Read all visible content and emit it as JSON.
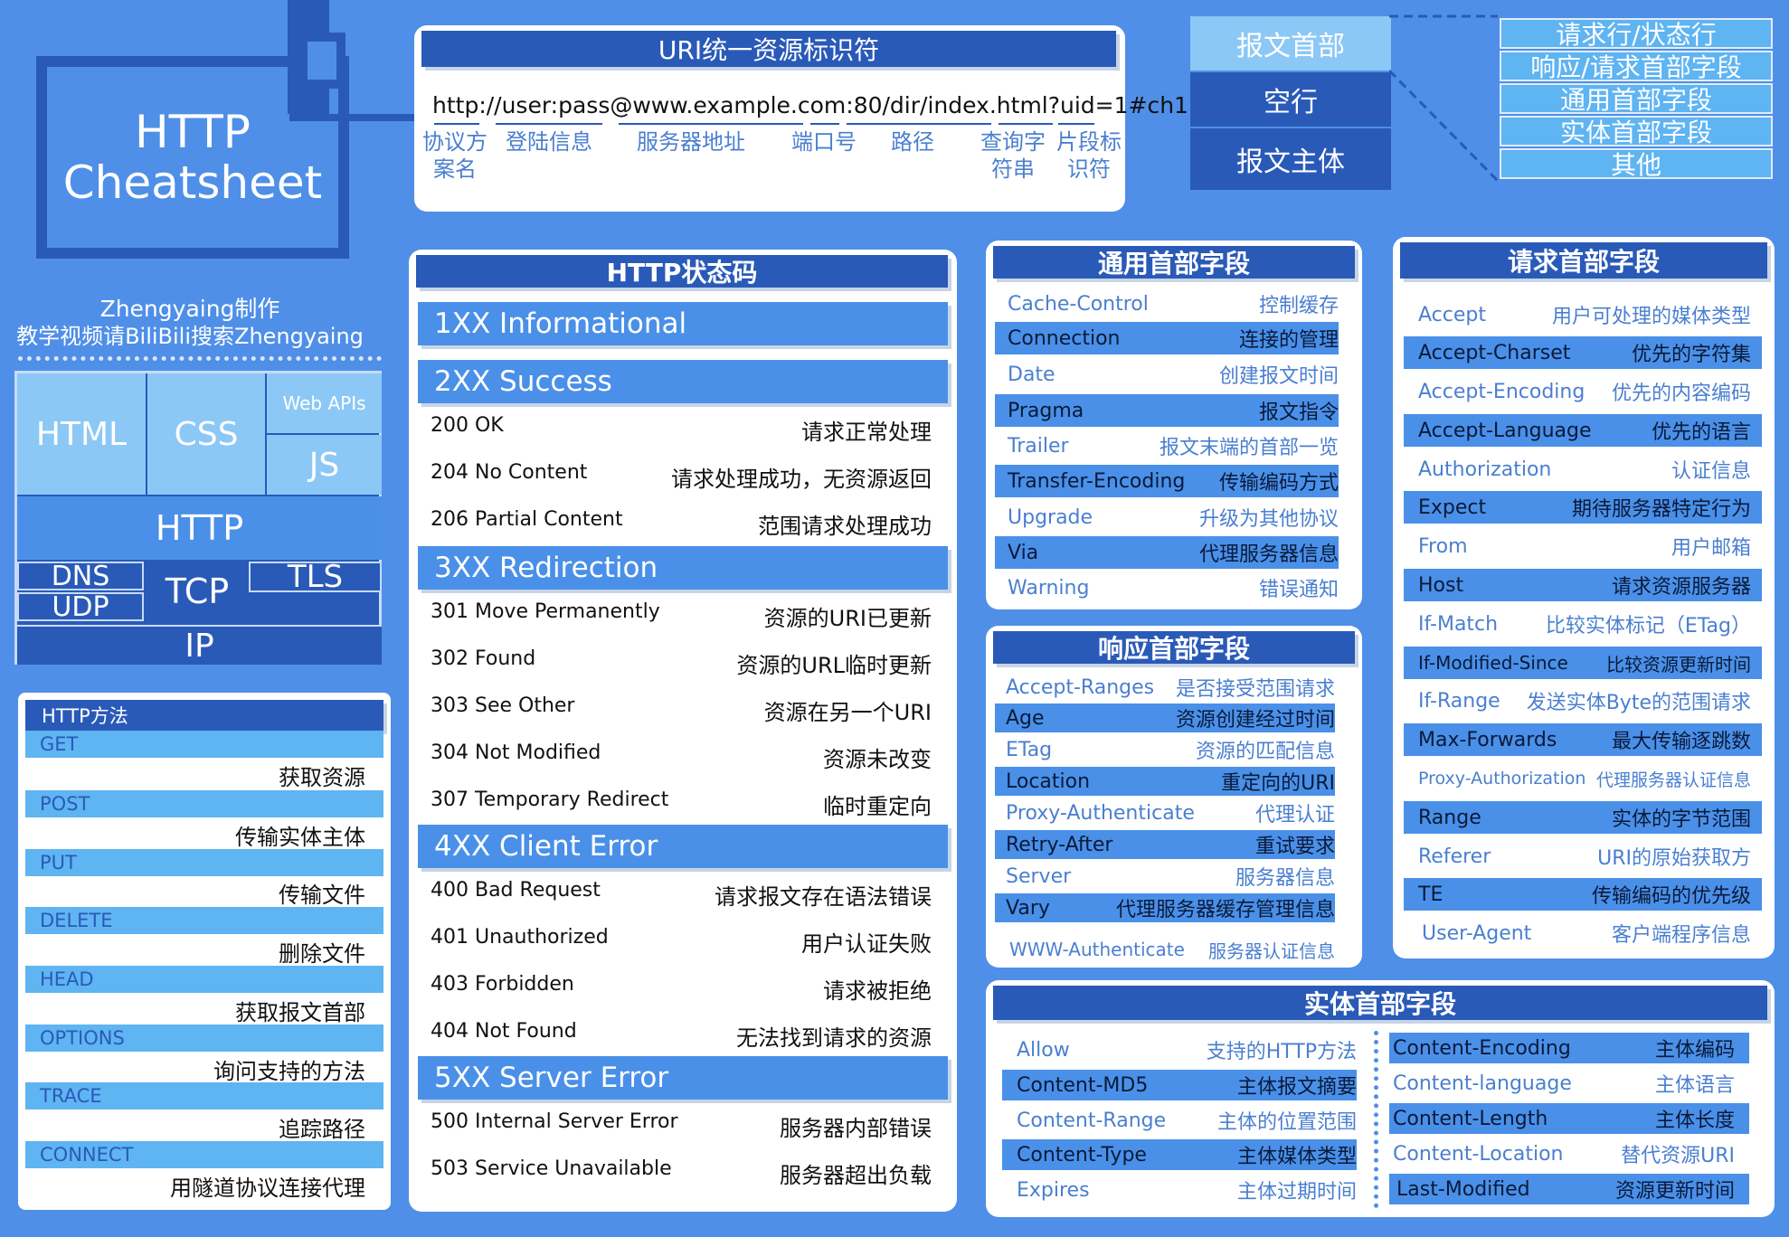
{
  "logo": {
    "line1": "HTTP",
    "line2": "Cheatsheet"
  },
  "credit": {
    "line1": "Zhengyaing制作",
    "line2": "教学视频请BiliBili搜索Zhengyaing"
  },
  "stack": {
    "html": "HTML",
    "css": "CSS",
    "webapis": "Web APIs",
    "js": "JS",
    "http": "HTTP",
    "dns": "DNS",
    "udp": "UDP",
    "tcp": "TCP",
    "tls": "TLS",
    "ip": "IP"
  },
  "uri": {
    "title": "URI统一资源标识符",
    "url": "http://user:pass@www.example.com:80/dir/index.html?uid=1#ch1",
    "labels": {
      "scheme": "协议方案名",
      "login": "登陆信息",
      "host": "服务器地址",
      "port": "端口号",
      "path": "路径",
      "query": "查询字符串",
      "fragment": "片段标识符"
    }
  },
  "message": {
    "header": "报文首部",
    "blank": "空行",
    "body": "报文主体",
    "parts": [
      "请求行/状态行",
      "响应/请求首部字段",
      "通用首部字段",
      "实体首部字段",
      "其他"
    ]
  },
  "status": {
    "title": "HTTP状态码",
    "sections": [
      {
        "name": "1XX Informational",
        "rows": []
      },
      {
        "name": "2XX Success",
        "rows": [
          [
            "200 OK",
            "请求正常处理"
          ],
          [
            "204 No Content",
            "请求处理成功，无资源返回"
          ],
          [
            "206 Partial Content",
            "范围请求处理成功"
          ]
        ]
      },
      {
        "name": "3XX Redirection",
        "rows": [
          [
            "301 Move Permanently",
            "资源的URI已更新"
          ],
          [
            "302 Found",
            "资源的URL临时更新"
          ],
          [
            "303 See Other",
            "资源在另一个URI"
          ],
          [
            "304 Not Modified",
            "资源未改变"
          ],
          [
            "307 Temporary Redirect",
            "临时重定向"
          ]
        ]
      },
      {
        "name": "4XX Client Error",
        "rows": [
          [
            "400 Bad Request",
            "请求报文存在语法错误"
          ],
          [
            "401 Unauthorized",
            "用户认证失败"
          ],
          [
            "403 Forbidden",
            "请求被拒绝"
          ],
          [
            "404 Not Found",
            "无法找到请求的资源"
          ]
        ]
      },
      {
        "name": "5XX Server Error",
        "rows": [
          [
            "500 Internal Server Error",
            "服务器内部错误"
          ],
          [
            "503 Service Unavailable",
            "服务器超出负载"
          ]
        ]
      }
    ]
  },
  "methods": {
    "title": "HTTP方法",
    "items": [
      [
        "GET",
        "获取资源"
      ],
      [
        "POST",
        "传输实体主体"
      ],
      [
        "PUT",
        "传输文件"
      ],
      [
        "DELETE",
        "删除文件"
      ],
      [
        "HEAD",
        "获取报文首部"
      ],
      [
        "OPTIONS",
        "询问支持的方法"
      ],
      [
        "TRACE",
        "追踪路径"
      ],
      [
        "CONNECT",
        "用隧道协议连接代理"
      ]
    ]
  },
  "general": {
    "title": "通用首部字段",
    "rows": [
      [
        "Cache-Control",
        "控制缓存"
      ],
      [
        "Connection",
        "连接的管理"
      ],
      [
        "Date",
        "创建报文时间"
      ],
      [
        "Pragma",
        "报文指令"
      ],
      [
        "Trailer",
        "报文末端的首部一览"
      ],
      [
        "Transfer-Encoding",
        "传输编码方式"
      ],
      [
        "Upgrade",
        "升级为其他协议"
      ],
      [
        "Via",
        "代理服务器信息"
      ],
      [
        "Warning",
        "错误通知"
      ]
    ]
  },
  "response": {
    "title": "响应首部字段",
    "rows": [
      [
        "Accept-Ranges",
        "是否接受范围请求"
      ],
      [
        "Age",
        "资源创建经过时间"
      ],
      [
        "ETag",
        "资源的匹配信息"
      ],
      [
        "Location",
        "重定向的URI"
      ],
      [
        "Proxy-Authenticate",
        "代理认证"
      ],
      [
        "Retry-After",
        "重试要求"
      ],
      [
        "Server",
        "服务器信息"
      ],
      [
        "Vary",
        "代理服务器缓存管理信息"
      ],
      [
        "WWW-Authenticate",
        "服务器认证信息"
      ]
    ]
  },
  "request": {
    "title": "请求首部字段",
    "rows": [
      [
        "Accept",
        "用户可处理的媒体类型"
      ],
      [
        "Accept-Charset",
        "优先的字符集"
      ],
      [
        "Accept-Encoding",
        "优先的内容编码"
      ],
      [
        "Accept-Language",
        "优先的语言"
      ],
      [
        "Authorization",
        "认证信息"
      ],
      [
        "Expect",
        "期待服务器特定行为"
      ],
      [
        "From",
        "用户邮箱"
      ],
      [
        "Host",
        "请求资源服务器"
      ],
      [
        "If-Match",
        "比较实体标记（ETag）"
      ],
      [
        "If-Modified-Since",
        "比较资源更新时间"
      ],
      [
        "If-Range",
        "发送实体Byte的范围请求"
      ],
      [
        "Max-Forwards",
        "最大传输逐跳数"
      ],
      [
        "Proxy-Authorization",
        "代理服务器认证信息"
      ],
      [
        "Range",
        "实体的字节范围"
      ],
      [
        "Referer",
        "URI的原始获取方"
      ],
      [
        "TE",
        "传输编码的优先级"
      ],
      [
        "User-Agent",
        "客户端程序信息"
      ]
    ]
  },
  "entity": {
    "title": "实体首部字段",
    "left": [
      [
        "Allow",
        "支持的HTTP方法"
      ],
      [
        "Content-MD5",
        "主体报文摘要"
      ],
      [
        "Content-Range",
        "主体的位置范围"
      ],
      [
        "Content-Type",
        "主体媒体类型"
      ],
      [
        "Expires",
        "主体过期时间"
      ]
    ],
    "right": [
      [
        "Content-Encoding",
        "主体编码"
      ],
      [
        "Content-language",
        "主体语言"
      ],
      [
        "Content-Length",
        "主体长度"
      ],
      [
        "Content-Location",
        "替代资源URI"
      ],
      [
        "Last-Modified",
        "资源更新时间"
      ]
    ]
  }
}
